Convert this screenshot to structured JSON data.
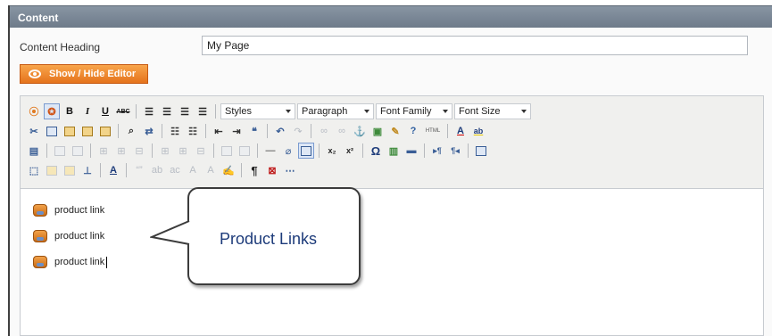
{
  "panel": {
    "title": "Content"
  },
  "form": {
    "heading_label": "Content Heading",
    "heading_value": "My Page",
    "toggle_editor_label": "Show / Hide Editor"
  },
  "toolbar": {
    "bold": "B",
    "italic": "I",
    "underline": "U",
    "strikethrough": "ABC",
    "styles": "Styles",
    "paragraph": "Paragraph",
    "font_family": "Font Family",
    "font_size": "Font Size",
    "html": "HTML",
    "font_color": "A",
    "highlight": "ab",
    "subscript": "x₂",
    "superscript": "x²",
    "special_char": "Ω",
    "paragraph_mark": "¶"
  },
  "content": {
    "product_links": [
      "product link",
      "product link",
      "product link"
    ]
  },
  "callout": {
    "text": "Product Links"
  },
  "colors": {
    "header": "#7a8696",
    "toggle_button": "#ef8a2d",
    "callout_text": "#1d3b7a"
  }
}
